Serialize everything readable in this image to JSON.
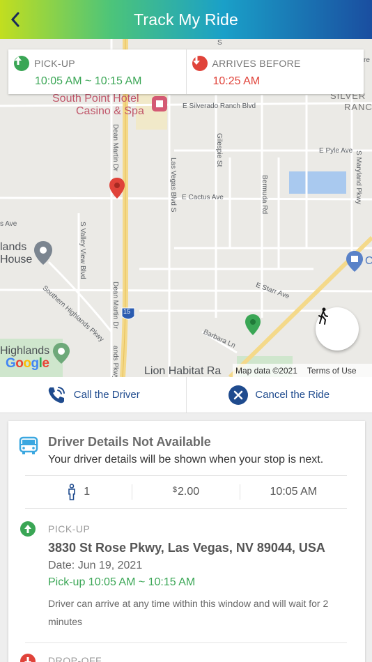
{
  "header": {
    "title": "Track My Ride"
  },
  "times": {
    "pickup_label": "PICK-UP",
    "pickup_window": "10:05 AM ~ 10:15 AM",
    "arrives_label": "ARRIVES BEFORE",
    "arrives_time": "10:25 AM"
  },
  "map": {
    "labels": {
      "south_point_1": "South Point Hotel",
      "south_point_2": "Casino & Spa",
      "silverado": "E Silverado Ranch Blvd",
      "silverado_2": "SILVER",
      "silverado_3": "RANC",
      "pyle": "E Pyle Ave",
      "cactus": "E Cactus Ave",
      "starr": "E Starr Ave",
      "barbara": "Barbara Ln",
      "dean_martin": "Dean Martin Dr",
      "dean_martin_2": "Dean Martin Dr",
      "las_vegas_blvd": "Las Vegas Blvd S",
      "gilespie": "Gilespie St",
      "bermuda": "Bermuda Rd",
      "maryland": "S Maryland Pkwy",
      "valley_view": "S Valley View Blvd",
      "southern_highlands": "Southern Highlands Pkwy",
      "s_ave": "s Ave",
      "lands_house_1": "lands",
      "lands_house_2": "House",
      "highlands": "Highlands",
      "lion": "Lion Habitat Ra",
      "highway": "15",
      "c_letter": "C",
      "re": "re",
      "s_top": "S",
      "s_pkwy": "ands Pkwy"
    },
    "google": "Google",
    "copyright": "Map data ©2021",
    "terms": "Terms of Use"
  },
  "actions": {
    "call_label": "Call the Driver",
    "cancel_label": "Cancel the Ride"
  },
  "driver": {
    "title": "Driver Details Not Available",
    "subtitle": "Your driver details will be shown when your stop is next."
  },
  "stats": {
    "passengers": "1",
    "currency": "$",
    "fare": "2.00",
    "time": "10:05 AM"
  },
  "pickup": {
    "label": "PICK-UP",
    "address": "3830 St Rose Pkwy, Las Vegas, NV 89044, USA",
    "date": "Date: Jun 19, 2021",
    "window": "Pick-up 10:05 AM ~ 10:15 AM",
    "note": "Driver can arrive at any time within this window and will wait for 2 minutes"
  },
  "dropoff": {
    "label": "DROP-OFF"
  },
  "colors": {
    "green": "#3aa655",
    "red": "#e0433a",
    "navy": "#1f4b8e"
  }
}
